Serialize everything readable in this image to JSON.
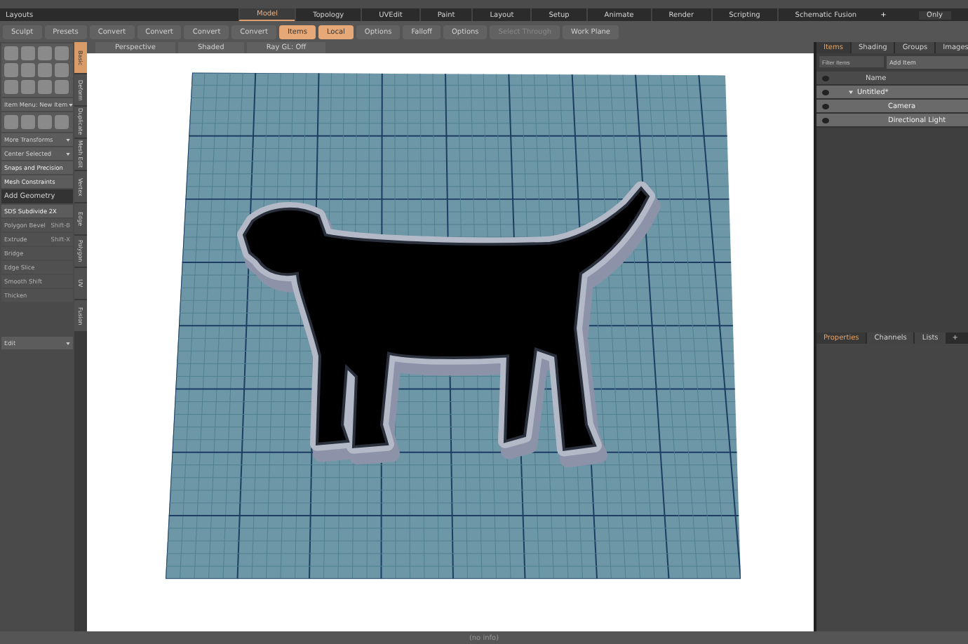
{
  "layout_bar": {
    "label": "Layouts",
    "tabs": [
      {
        "label": "Model",
        "selected": true
      },
      {
        "label": "Topology",
        "selected": false
      },
      {
        "label": "UVEdit",
        "selected": false
      },
      {
        "label": "Paint",
        "selected": false
      },
      {
        "label": "Layout",
        "selected": false
      },
      {
        "label": "Setup",
        "selected": false
      },
      {
        "label": "Animate",
        "selected": false
      },
      {
        "label": "Render",
        "selected": false
      },
      {
        "label": "Scripting",
        "selected": false
      },
      {
        "label": "Schematic Fusion",
        "selected": false
      }
    ],
    "add": "+",
    "only": "Only"
  },
  "toolbar": [
    {
      "label": "Sculpt",
      "selected": false,
      "disabled": false
    },
    {
      "label": "Presets",
      "selected": false,
      "disabled": false
    },
    {
      "label": "Convert",
      "selected": false,
      "disabled": false
    },
    {
      "label": "Convert",
      "selected": false,
      "disabled": false
    },
    {
      "label": "Convert",
      "selected": false,
      "disabled": false
    },
    {
      "label": "Convert",
      "selected": false,
      "disabled": false
    },
    {
      "label": "Items",
      "selected": true,
      "disabled": false
    },
    {
      "label": "Local",
      "selected": true,
      "disabled": false
    },
    {
      "label": "Options",
      "selected": false,
      "disabled": false
    },
    {
      "label": "Falloff",
      "selected": false,
      "disabled": false
    },
    {
      "label": "Options",
      "selected": false,
      "disabled": false
    },
    {
      "label": "Select Through",
      "selected": false,
      "disabled": true
    },
    {
      "label": "Work Plane",
      "selected": false,
      "disabled": false
    }
  ],
  "tool_panel": {
    "items": [
      {
        "kind": "dropdown",
        "label": "Item Menu: New Item"
      },
      {
        "kind": "dropdown",
        "label": "More Transforms"
      },
      {
        "kind": "dropdown",
        "label": "Center Selected"
      },
      {
        "kind": "tool",
        "label": "Snaps and Precision",
        "disabled": false
      },
      {
        "kind": "tool",
        "label": "Mesh Constraints",
        "disabled": false
      },
      {
        "kind": "header",
        "label": "Add Geometry"
      },
      {
        "kind": "tool",
        "label": "SDS Subdivide 2X",
        "disabled": false
      },
      {
        "kind": "tool",
        "label": "Polygon Bevel",
        "shortcut": "Shift-B",
        "disabled": true
      },
      {
        "kind": "tool",
        "label": "Extrude",
        "shortcut": "Shift-X",
        "disabled": true
      },
      {
        "kind": "tool",
        "label": "Bridge",
        "disabled": true
      },
      {
        "kind": "tool",
        "label": "Edge Slice",
        "disabled": true
      },
      {
        "kind": "tool",
        "label": "Smooth Shift",
        "disabled": true
      },
      {
        "kind": "tool",
        "label": "Thicken",
        "disabled": true
      }
    ],
    "bottom_dropdown": "Edit",
    "side_tabs": [
      {
        "label": "Basic",
        "selected": true
      },
      {
        "label": "Deform",
        "selected": false
      },
      {
        "label": "Duplicate",
        "selected": false
      },
      {
        "label": "Mesh Edit",
        "selected": false
      },
      {
        "label": "Vertex",
        "selected": false
      },
      {
        "label": "Edge",
        "selected": false
      },
      {
        "label": "Polygon",
        "selected": false
      },
      {
        "label": "UV",
        "selected": false
      },
      {
        "label": "Fusion",
        "selected": false
      }
    ]
  },
  "viewport": {
    "controls": [
      "Perspective",
      "Shaded",
      "Ray GL: Off"
    ]
  },
  "items_panel": {
    "tabs": [
      {
        "label": "Items",
        "selected": true
      },
      {
        "label": "Shading",
        "selected": false
      },
      {
        "label": "Groups",
        "selected": false
      },
      {
        "label": "Images",
        "selected": false
      }
    ],
    "filter_placeholder": "Filter Items",
    "add_item": "Add Item",
    "column": "Name",
    "tree": [
      {
        "label": "Untitled*",
        "expanded": true,
        "children": [
          {
            "label": "Camera"
          },
          {
            "label": "Directional Light"
          }
        ]
      }
    ]
  },
  "properties_panel": {
    "tabs": [
      {
        "label": "Properties",
        "selected": true
      },
      {
        "label": "Channels",
        "selected": false
      },
      {
        "label": "Lists",
        "selected": false
      }
    ],
    "add": "+"
  },
  "status_bar": "(no info)"
}
